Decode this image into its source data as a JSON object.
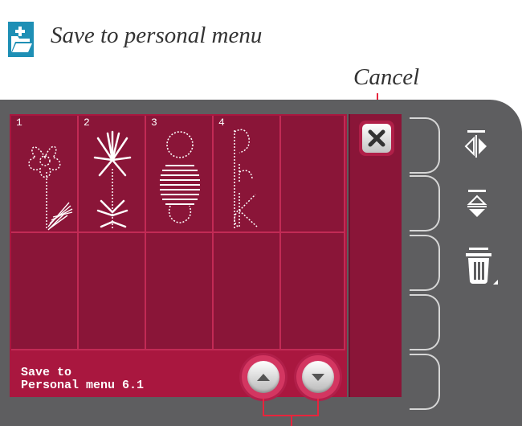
{
  "header": {
    "icon": "folder-save-icon",
    "title": "Save to personal menu"
  },
  "callouts": {
    "cancel": "Cancel"
  },
  "grid": {
    "cells": [
      {
        "number": "1",
        "icon": "flower-stitch-icon"
      },
      {
        "number": "2",
        "icon": "daisy-stitch-icon"
      },
      {
        "number": "3",
        "icon": "snowman-stitch-icon"
      },
      {
        "number": "4",
        "icon": "letters-stitch-icon"
      },
      {
        "number": "",
        "icon": ""
      },
      {
        "number": "",
        "icon": ""
      },
      {
        "number": "",
        "icon": ""
      },
      {
        "number": "",
        "icon": ""
      },
      {
        "number": "",
        "icon": ""
      },
      {
        "number": "",
        "icon": ""
      }
    ]
  },
  "status": {
    "line1": "Save to",
    "line2": "Personal menu 6.1"
  },
  "buttons": {
    "scroll_up": "arrow-up-icon",
    "scroll_down": "arrow-down-icon",
    "cancel": "close-icon"
  },
  "side_icons": {
    "mirror_horizontal": "mirror-side-to-side-icon",
    "mirror_vertical": "mirror-end-to-end-icon",
    "delete": "trash-icon"
  },
  "colors": {
    "panel": "#a9173f",
    "cell": "#8a1538",
    "device": "#5e5e60",
    "accent_red": "#e8243c",
    "icon_blue": "#1e8fb5"
  }
}
